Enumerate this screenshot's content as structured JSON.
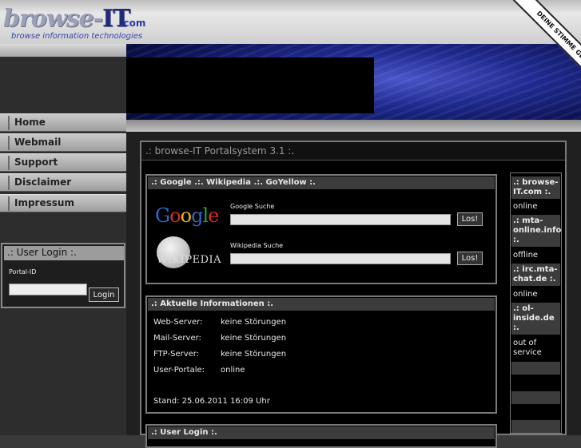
{
  "header": {
    "logo_main": "browse-",
    "logo_it": "IT",
    "logo_tld": ".com",
    "logo_sub": "browse information technologies",
    "ribbon_text": "DEINE STIMME GEGEN ARMUT"
  },
  "nav": {
    "items": [
      {
        "label": "Home"
      },
      {
        "label": "Webmail"
      },
      {
        "label": "Support"
      },
      {
        "label": "Disclaimer"
      },
      {
        "label": "Impressum"
      }
    ]
  },
  "sidebar_login": {
    "title": ".: User Login :.",
    "field_label": "Portal-ID",
    "field_value": "",
    "button_label": "Login"
  },
  "main": {
    "title": ".: browse-IT Portalsystem 3.1 :.",
    "search_panel": {
      "title": ".: Google .:. Wikipedia .:. GoYellow :.",
      "google_logo": "Google",
      "google_label": "Google Suche",
      "google_value": "",
      "google_button": "Los!",
      "wiki_logo": "WIKIPEDIA",
      "wiki_label": "Wikipedia Suche",
      "wiki_value": "",
      "wiki_button": "Los!"
    },
    "info_panel": {
      "title": ".: Aktuelle Informationen :.",
      "rows": [
        {
          "label": "Web-Server:",
          "value": "keine Störungen"
        },
        {
          "label": "Mail-Server:",
          "value": "keine Störungen"
        },
        {
          "label": "FTP-Server:",
          "value": "keine Störungen"
        },
        {
          "label": "User-Portale:",
          "value": "online"
        }
      ],
      "stand": "Stand: 25.06.2011 16:09 Uhr"
    },
    "login_panel": {
      "title": ".: User Login :."
    },
    "status_column": {
      "entries": [
        {
          "name": ".: browse-IT.com :.",
          "status": "online"
        },
        {
          "name": ".: mta-online.info :.",
          "status": "offline"
        },
        {
          "name": ".: irc.mta-chat.de :.",
          "status": "online"
        },
        {
          "name": ".: ol-inside.de :.",
          "status": "out of service"
        }
      ]
    }
  },
  "colors": {
    "accent_google_blue": "#3366cc",
    "accent_google_red": "#d62d20",
    "accent_google_yellow": "#f2b50f",
    "accent_google_green": "#2a9d3a",
    "logo_blue": "#2b3aa0"
  }
}
